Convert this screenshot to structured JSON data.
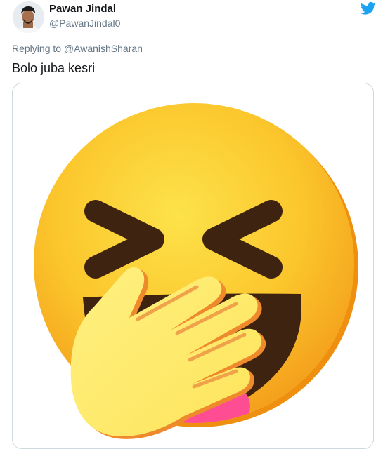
{
  "tweet": {
    "author": {
      "display_name": "Pawan Jindal",
      "handle": "@PawanJindal0",
      "avatar_icon": "user-avatar-photo"
    },
    "platform_icon": "twitter-bird-icon",
    "reply_context": "Replying to @AwanishSharan",
    "text": "Bolo juba kesri",
    "media": {
      "type": "image",
      "icon": "face-with-hand-over-mouth-laughing-emoji"
    }
  },
  "colors": {
    "twitter_blue": "#1da1f2",
    "text_primary": "#14171a",
    "text_secondary": "#657786",
    "card_border": "#cfd9de",
    "emoji_yellow": "#fbc02d",
    "emoji_hand": "#ffeb7a",
    "emoji_tongue": "#ff4d94"
  }
}
